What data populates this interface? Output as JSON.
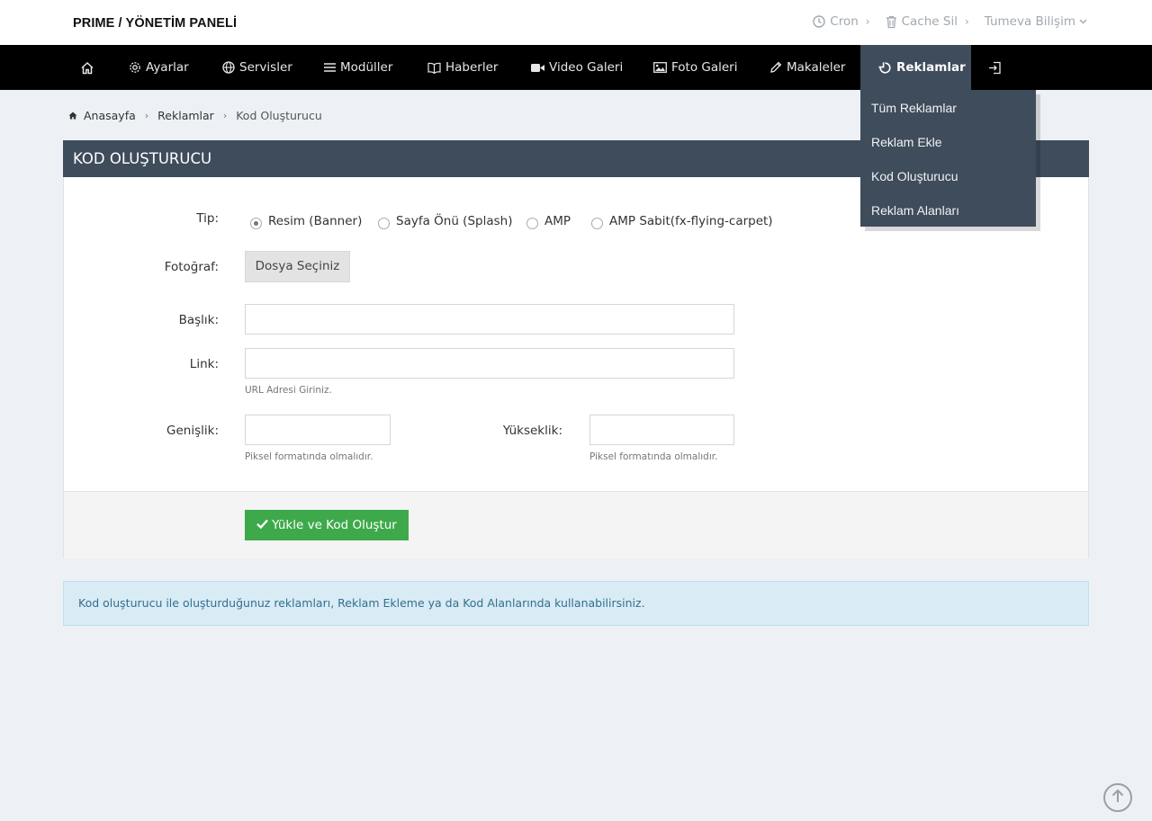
{
  "header": {
    "brand": "PRIME / YÖNETİM PANELİ",
    "links": [
      {
        "label": "Cron",
        "icon": "clock-icon"
      },
      {
        "label": "Cache Sil",
        "icon": "trash-icon"
      },
      {
        "label": "Tumeva Bilişim",
        "icon": "chevron-down-icon"
      }
    ]
  },
  "nav": {
    "items": [
      {
        "label": "",
        "icon": "home-icon"
      },
      {
        "label": "Ayarlar",
        "icon": "gear-icon"
      },
      {
        "label": "Servisler",
        "icon": "globe-icon"
      },
      {
        "label": "Modüller",
        "icon": "list-icon"
      },
      {
        "label": "Haberler",
        "icon": "book-icon"
      },
      {
        "label": "Video Galeri",
        "icon": "video-icon"
      },
      {
        "label": "Foto Galeri",
        "icon": "image-icon"
      },
      {
        "label": "Makaleler",
        "icon": "pencil-icon"
      },
      {
        "label": "Reklamlar",
        "icon": "pie-icon"
      },
      {
        "label": "",
        "icon": "logout-icon"
      }
    ],
    "active": "Reklamlar",
    "dropdown": [
      "Tüm Reklamlar",
      "Reklam Ekle",
      "Kod Oluşturucu",
      "Reklam Alanları"
    ]
  },
  "breadcrumb": {
    "home": "Anasayfa",
    "parent": "Reklamlar",
    "current": "Kod Oluşturucu"
  },
  "panel": {
    "title": "KOD OLUŞTURUCU",
    "type_label": "Tip:",
    "type_options": [
      "Resim (Banner)",
      "Sayfa Önü (Splash)",
      "AMP",
      "AMP Sabit(fx-flying-carpet)"
    ],
    "type_selected": "Resim (Banner)",
    "photo_label": "Fotoğraf:",
    "file_button": "Dosya Seçiniz",
    "title_label": "Başlık:",
    "title_value": "",
    "link_label": "Link:",
    "link_value": "",
    "link_help": "URL Adresi Giriniz.",
    "width_label": "Genişlik:",
    "width_value": "",
    "width_help": "Piksel formatında olmalıdır.",
    "height_label": "Yükseklik:",
    "height_value": "",
    "height_help": "Piksel formatında olmalıdır.",
    "submit": "Yükle ve Kod Oluştur"
  },
  "alert": "Kod oluşturucu ile oluşturduğunuz reklamları, Reklam Ekleme ya da Kod Alanlarında kullanabilirsiniz.",
  "colors": {
    "nav_bg": "#000000",
    "panel_head": "#3e4c5c",
    "submit_green": "#3ea94a",
    "alert_bg": "#d9ebf5",
    "page_bg": "#edf1f5"
  }
}
